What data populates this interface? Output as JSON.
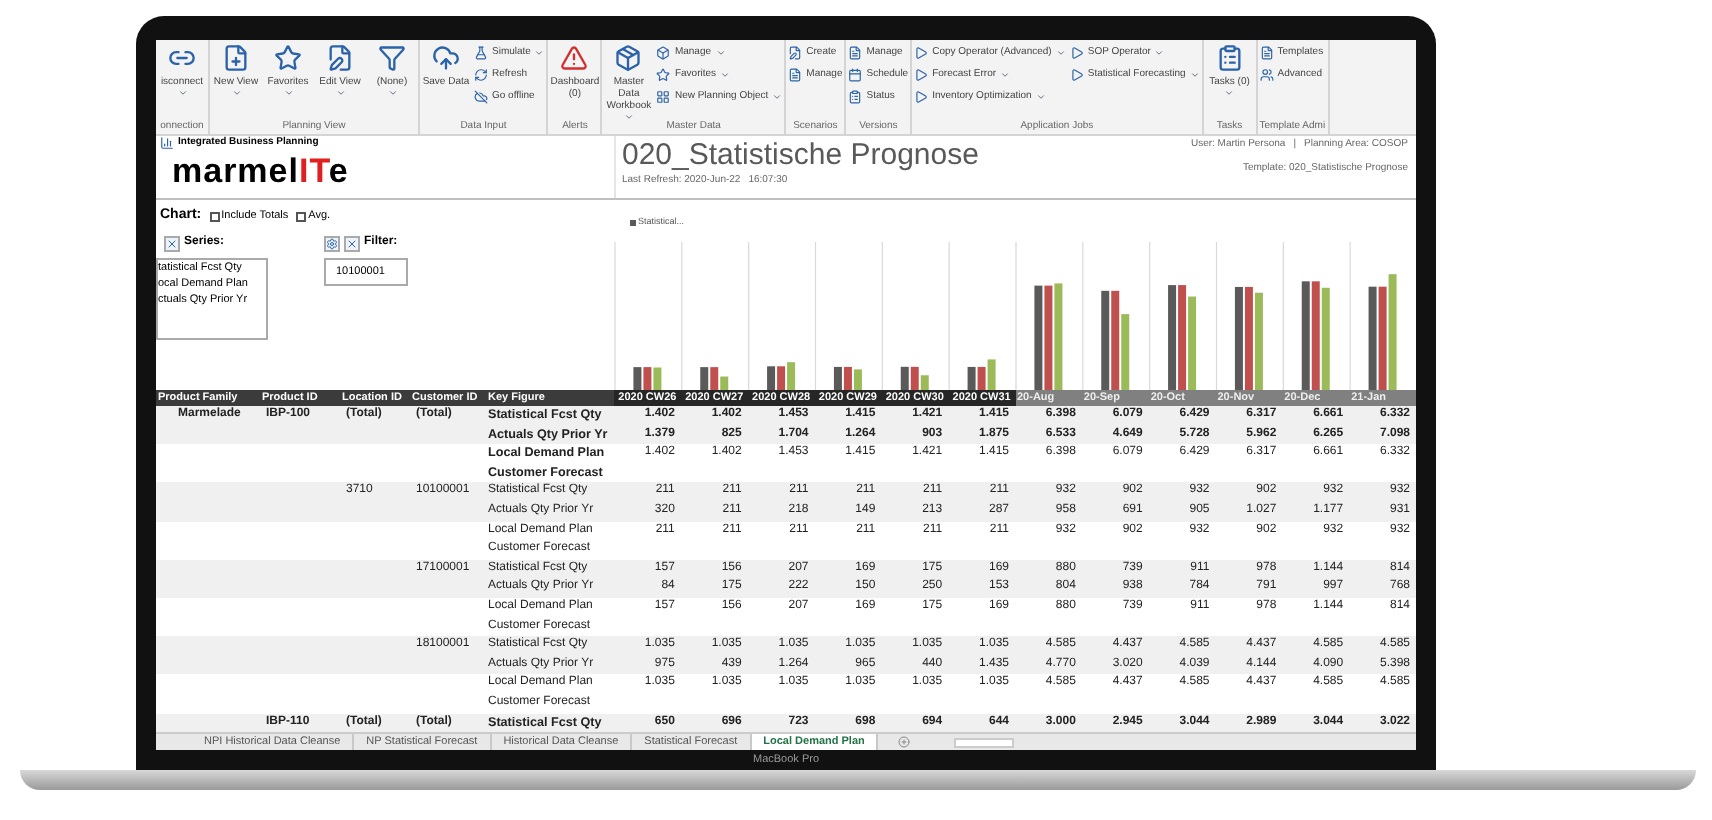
{
  "ribbon": {
    "groups": [
      {
        "label": "onnection",
        "items": [
          {
            "label": "isconnect",
            "kind": "large",
            "dropdown": true
          }
        ]
      },
      {
        "label": "Planning View",
        "items": [
          {
            "label": "New View",
            "kind": "large",
            "dropdown": true
          },
          {
            "label": "Favorites",
            "kind": "large",
            "dropdown": true
          },
          {
            "label": "Edit View",
            "kind": "large",
            "dropdown": true
          },
          {
            "label": "(None)",
            "kind": "large",
            "dropdown": true
          }
        ]
      },
      {
        "label": "Data Input",
        "items": [
          {
            "label": "Save Data",
            "kind": "large",
            "dropdown": false
          },
          {
            "label": "Simulate",
            "kind": "small",
            "dropdown": true
          },
          {
            "label": "Refresh",
            "kind": "small",
            "dropdown": false
          },
          {
            "label": "Go offline",
            "kind": "small",
            "dropdown": false
          }
        ]
      },
      {
        "label": "Alerts",
        "items": [
          {
            "label": "Dashboard (0)",
            "kind": "large",
            "dropdown": false
          }
        ]
      },
      {
        "label": "Master Data",
        "items": [
          {
            "label": "Master Data Workbook",
            "kind": "large",
            "dropdown": true
          },
          {
            "label": "Manage",
            "kind": "small",
            "dropdown": true
          },
          {
            "label": "Favorites",
            "kind": "small",
            "dropdown": true
          },
          {
            "label": "New Planning Object",
            "kind": "small",
            "dropdown": true
          }
        ]
      },
      {
        "label": "Scenarios",
        "items": [
          {
            "label": "Create",
            "kind": "small",
            "dropdown": false
          },
          {
            "label": "Manage",
            "kind": "small",
            "dropdown": false
          }
        ]
      },
      {
        "label": "Versions",
        "items": [
          {
            "label": "Manage",
            "kind": "small",
            "dropdown": false
          },
          {
            "label": "Schedule",
            "kind": "small",
            "dropdown": false
          },
          {
            "label": "Status",
            "kind": "small",
            "dropdown": false
          }
        ]
      },
      {
        "label": "Application Jobs",
        "items": [
          {
            "label": "Copy Operator (Advanced)",
            "kind": "small",
            "dropdown": true
          },
          {
            "label": "Forecast Error",
            "kind": "small",
            "dropdown": true
          },
          {
            "label": "Inventory Optimization",
            "kind": "small",
            "dropdown": true
          },
          {
            "label": "SOP Operator",
            "kind": "small",
            "dropdown": true
          },
          {
            "label": "Statistical Forecasting",
            "kind": "small",
            "dropdown": true
          }
        ]
      },
      {
        "label": "Tasks",
        "items": [
          {
            "label": "Tasks (0)",
            "kind": "large",
            "dropdown": true
          }
        ]
      },
      {
        "label": "Template Admi",
        "items": [
          {
            "label": "Templates",
            "kind": "small",
            "dropdown": false
          },
          {
            "label": "Advanced",
            "kind": "small",
            "dropdown": false
          }
        ]
      }
    ]
  },
  "header": {
    "app_name": "Integrated Business Planning",
    "logo": {
      "before": "marmel",
      "highlight": "IT",
      "after": "e"
    },
    "title": "020_Statistische Prognose",
    "last_refresh": [
      "Last Refresh: 2020-Jun-22",
      "16:07:30"
    ],
    "user_info": [
      "User: Martin Persona",
      "|",
      "Planning Area: COSOP"
    ],
    "template": "Template: 020_Statistische Prognose"
  },
  "chart_panel": {
    "label": "Chart:",
    "options": [
      {
        "label": "Include Totals",
        "checked": false
      },
      {
        "label": "Avg.",
        "checked": false
      }
    ],
    "series_label": "Series:",
    "series": [
      "tatistical Fcst Qty",
      "ocal Demand Plan",
      "ctuals Qty Prior Yr"
    ],
    "filter_label": "Filter:",
    "filter_value": "10100001",
    "legend": "Statistical..."
  },
  "table": {
    "columns": [
      {
        "label": "Product Family",
        "kind": "attribute"
      },
      {
        "label": "Product ID",
        "kind": "attribute"
      },
      {
        "label": "Location ID",
        "kind": "attribute"
      },
      {
        "label": "Customer ID",
        "kind": "attribute"
      },
      {
        "label": "Key Figure",
        "kind": "attribute"
      },
      {
        "label": "2020 CW26",
        "kind": "week"
      },
      {
        "label": "2020 CW27",
        "kind": "week"
      },
      {
        "label": "2020 CW28",
        "kind": "week"
      },
      {
        "label": "2020 CW29",
        "kind": "week"
      },
      {
        "label": "2020 CW30",
        "kind": "week"
      },
      {
        "label": "2020 CW31",
        "kind": "week"
      },
      {
        "label": "20-Aug",
        "kind": "month"
      },
      {
        "label": "20-Sep",
        "kind": "month"
      },
      {
        "label": "20-Oct",
        "kind": "month"
      },
      {
        "label": "20-Nov",
        "kind": "month"
      },
      {
        "label": "20-Dec",
        "kind": "month"
      },
      {
        "label": "21-Jan",
        "kind": "month"
      }
    ],
    "rows": [
      {
        "kind": "total",
        "family": "Marmelade",
        "product": "IBP-100",
        "location": "(Total)",
        "customer": "(Total)",
        "key_figure": "Statistical Fcst Qty",
        "values": [
          "1.402",
          "1.402",
          "1.453",
          "1.415",
          "1.421",
          "1.415",
          "6.398",
          "6.079",
          "6.429",
          "6.317",
          "6.661",
          "6.332"
        ]
      },
      {
        "kind": "total",
        "key_figure": "Actuals Qty Prior Yr",
        "values": [
          "1.379",
          "825",
          "1.704",
          "1.264",
          "903",
          "1.875",
          "6.533",
          "4.649",
          "5.728",
          "5.962",
          "6.265",
          "7.098"
        ]
      },
      {
        "kind": "subtotal",
        "key_figure": "Local Demand Plan",
        "values": [
          "1.402",
          "1.402",
          "1.453",
          "1.415",
          "1.421",
          "1.415",
          "6.398",
          "6.079",
          "6.429",
          "6.317",
          "6.661",
          "6.332"
        ]
      },
      {
        "kind": "subtotal",
        "key_figure": "Customer Forecast"
      },
      {
        "kind": "detail",
        "location": "3710",
        "customer": "10100001",
        "key_figure": "Statistical Fcst Qty",
        "values": [
          "211",
          "211",
          "211",
          "211",
          "211",
          "211",
          "932",
          "902",
          "932",
          "902",
          "932",
          "932"
        ]
      },
      {
        "kind": "detail",
        "key_figure": "Actuals Qty Prior Yr",
        "values": [
          "320",
          "211",
          "218",
          "149",
          "213",
          "287",
          "958",
          "691",
          "905",
          "1.027",
          "1.177",
          "931"
        ]
      },
      {
        "kind": "detail",
        "key_figure": "Local Demand Plan",
        "values": [
          "211",
          "211",
          "211",
          "211",
          "211",
          "211",
          "932",
          "902",
          "932",
          "902",
          "932",
          "932"
        ]
      },
      {
        "kind": "detail",
        "key_figure": "Customer Forecast"
      },
      {
        "kind": "detail",
        "customer": "17100001",
        "key_figure": "Statistical Fcst Qty",
        "values": [
          "157",
          "156",
          "207",
          "169",
          "175",
          "169",
          "880",
          "739",
          "911",
          "978",
          "1.144",
          "814"
        ]
      },
      {
        "kind": "detail",
        "key_figure": "Actuals Qty Prior Yr",
        "values": [
          "84",
          "175",
          "222",
          "150",
          "250",
          "153",
          "804",
          "938",
          "784",
          "791",
          "997",
          "768"
        ]
      },
      {
        "kind": "detail",
        "key_figure": "Local Demand Plan",
        "values": [
          "157",
          "156",
          "207",
          "169",
          "175",
          "169",
          "880",
          "739",
          "911",
          "978",
          "1.144",
          "814"
        ]
      },
      {
        "kind": "detail",
        "key_figure": "Customer Forecast"
      },
      {
        "kind": "detail",
        "customer": "18100001",
        "key_figure": "Statistical Fcst Qty",
        "values": [
          "1.035",
          "1.035",
          "1.035",
          "1.035",
          "1.035",
          "1.035",
          "4.585",
          "4.437",
          "4.585",
          "4.437",
          "4.585",
          "4.585"
        ]
      },
      {
        "kind": "detail",
        "key_figure": "Actuals Qty Prior Yr",
        "values": [
          "975",
          "439",
          "1.264",
          "965",
          "440",
          "1.435",
          "4.770",
          "3.020",
          "4.039",
          "4.144",
          "4.090",
          "5.398"
        ]
      },
      {
        "kind": "detail",
        "key_figure": "Local Demand Plan",
        "values": [
          "1.035",
          "1.035",
          "1.035",
          "1.035",
          "1.035",
          "1.035",
          "4.585",
          "4.437",
          "4.585",
          "4.437",
          "4.585",
          "4.585"
        ]
      },
      {
        "kind": "detail",
        "key_figure": "Customer Forecast"
      },
      {
        "kind": "total",
        "product": "IBP-110",
        "location": "(Total)",
        "customer": "(Total)",
        "key_figure": "Statistical Fcst Qty",
        "values": [
          "650",
          "696",
          "723",
          "698",
          "694",
          "644",
          "3.000",
          "2.945",
          "3.044",
          "2.989",
          "3.044",
          "3.022"
        ]
      }
    ]
  },
  "sheet_tabs": [
    {
      "label": "NPI Historical Data Cleanse",
      "selected": false
    },
    {
      "label": "NP Statistical Forecast",
      "selected": false
    },
    {
      "label": "Historical Data Cleanse",
      "selected": false
    },
    {
      "label": "Statistical Forecast",
      "selected": false
    },
    {
      "label": "Local Demand Plan",
      "selected": true
    }
  ],
  "device_label": "MacBook Pro"
}
